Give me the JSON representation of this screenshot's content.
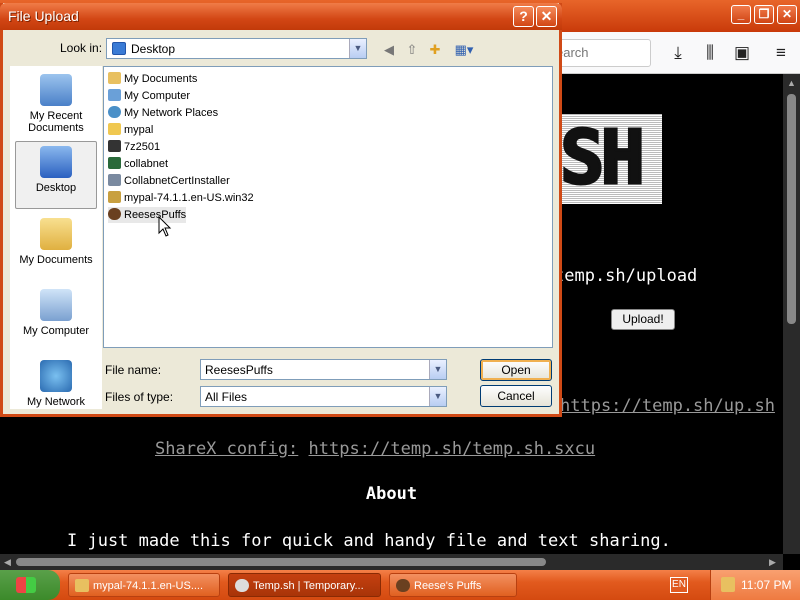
{
  "browser": {
    "search_placeholder": "earch",
    "controls": {
      "minimize": "_",
      "restore": "❐",
      "close": "✕"
    },
    "toolbar_icons": [
      "download-icon",
      "library-icon",
      "sidebar-icon",
      "menu-icon"
    ],
    "page": {
      "logo_text": "SH",
      "upload_url": "temp.sh/upload",
      "upload_button": "Upload!",
      "curl_url": "https://temp.sh/up.sh",
      "sharex_label": "ShareX config:",
      "sharex_url": "https://temp.sh/temp.sh.sxcu",
      "about_title": "About",
      "about_text": "I just made this for quick and handy file and text sharing."
    }
  },
  "dialog": {
    "title": "File Upload",
    "help_button": "?",
    "close_button": "✕",
    "lookin_label": "Look in:",
    "lookin_value": "Desktop",
    "places": [
      {
        "label": "My Recent Documents",
        "icon": "recent-documents-icon"
      },
      {
        "label": "Desktop",
        "icon": "desktop-icon",
        "selected": true
      },
      {
        "label": "My Documents",
        "icon": "my-documents-icon"
      },
      {
        "label": "My Computer",
        "icon": "my-computer-icon"
      },
      {
        "label": "My Network",
        "icon": "my-network-icon"
      }
    ],
    "files": [
      {
        "name": "My Documents",
        "icon": "folder-docs-icon",
        "color": "#e8c060"
      },
      {
        "name": "My Computer",
        "icon": "computer-icon",
        "color": "#6aa0d8"
      },
      {
        "name": "My Network Places",
        "icon": "network-icon",
        "color": "#4a90c8"
      },
      {
        "name": "mypal",
        "icon": "folder-icon",
        "color": "#f0c850"
      },
      {
        "name": "7z2501",
        "icon": "7zip-icon",
        "color": "#333333"
      },
      {
        "name": "collabnet",
        "icon": "shortcut-icon",
        "color": "#2a6a3a"
      },
      {
        "name": "CollabnetCertInstaller",
        "icon": "installer-icon",
        "color": "#7a8aa0"
      },
      {
        "name": "mypal-74.1.1.en-US.win32",
        "icon": "archive-icon",
        "color": "#c8a040"
      },
      {
        "name": "ReesesPuffs",
        "icon": "image-icon",
        "color": "#6a4020"
      }
    ],
    "filename_label": "File name:",
    "filename_value": "ReesesPuffs",
    "filetype_label": "Files of type:",
    "filetype_value": "All Files",
    "open_button": "Open",
    "cancel_button": "Cancel"
  },
  "taskbar": {
    "tasks": [
      {
        "label": "mypal-74.1.1.en-US....",
        "icon": "archive-icon"
      },
      {
        "label": "Temp.sh | Temporary...",
        "icon": "browser-icon"
      },
      {
        "label": "Reese's Puffs",
        "icon": "image-icon"
      }
    ],
    "language": "EN",
    "clock": "11:07 PM"
  }
}
